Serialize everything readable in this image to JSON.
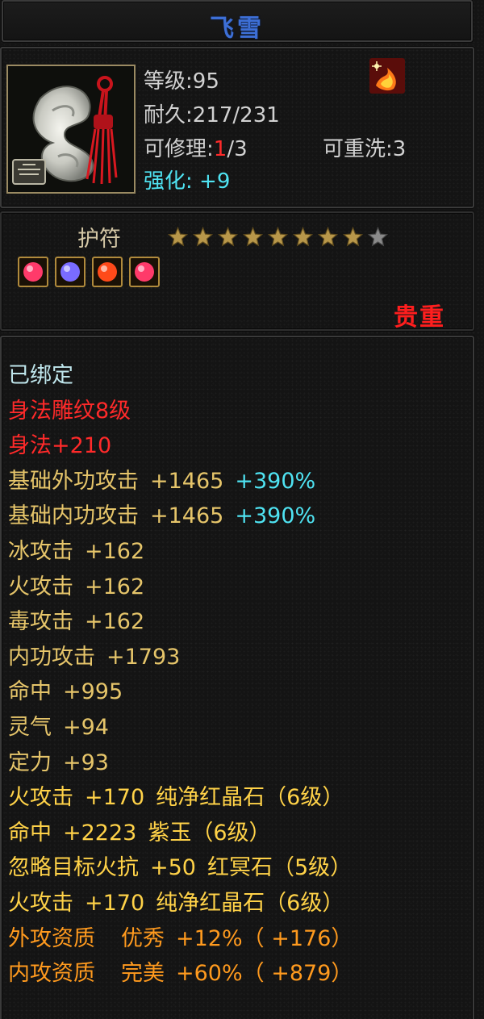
{
  "item": {
    "name": "飞雪",
    "level_label": "等级",
    "level_value": "95",
    "durability_label": "耐久",
    "durability_value": "217/231",
    "repair_label": "可修理",
    "repair_used": "1",
    "repair_total": "/3",
    "rewash_label": "可重洗",
    "rewash_value": "3",
    "enhance_label": "强化",
    "enhance_value": "+9",
    "type": "护符",
    "stars_filled": 8,
    "stars_total": 9,
    "rarity": "贵重",
    "icon": "jade-amulet-icon",
    "badge_icon": "fire-phoenix-badge-icon"
  },
  "gems": [
    {
      "icon": "red-crystal-gem-icon",
      "color": "#ff3a6a"
    },
    {
      "icon": "purple-jade-gem-icon",
      "color": "#7a6cff"
    },
    {
      "icon": "red-nether-gem-icon",
      "color": "#ff4a1a"
    },
    {
      "icon": "red-crystal-gem-icon",
      "color": "#ff3a6a"
    }
  ],
  "attributes": {
    "bound": "已绑定",
    "carving": "身法雕纹8级",
    "agility": {
      "name": "身法",
      "value": "+210"
    },
    "base_ext_attack": {
      "name": "基础外功攻击",
      "value": "+1465",
      "pct": "+390%"
    },
    "base_int_attack": {
      "name": "基础内功攻击",
      "value": "+1465",
      "pct": "+390%"
    },
    "ice_attack": {
      "name": "冰攻击",
      "value": "+162"
    },
    "fire_attack": {
      "name": "火攻击",
      "value": "+162"
    },
    "poison_attack": {
      "name": "毒攻击",
      "value": "+162"
    },
    "int_attack": {
      "name": "内功攻击",
      "value": "+1793"
    },
    "hit": {
      "name": "命中",
      "value": "+995"
    },
    "spirit": {
      "name": "灵气",
      "value": "+94"
    },
    "focus": {
      "name": "定力",
      "value": "+93"
    },
    "gem1": {
      "name": "火攻击",
      "value": "+170",
      "gem": "纯净红晶石（6级）"
    },
    "gem2": {
      "name": "命中",
      "value": "+2223",
      "gem": "紫玉（6级）"
    },
    "gem3": {
      "name": "忽略目标火抗",
      "value": "+50",
      "gem": "红冥石（5级）"
    },
    "gem4": {
      "name": "火攻击",
      "value": "+170",
      "gem": "纯净红晶石（6级）"
    },
    "ext_quality": {
      "name": "外攻资质",
      "grade": "优秀",
      "pct": "+12%",
      "bonus": "（ +176）"
    },
    "int_quality": {
      "name": "内攻资质",
      "grade": "完美",
      "pct": "+60%",
      "bonus": "（ +879）"
    }
  }
}
